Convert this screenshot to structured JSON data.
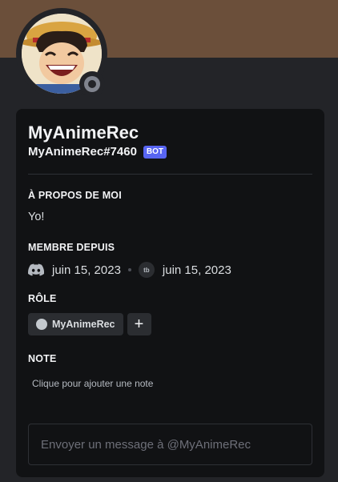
{
  "colors": {
    "banner": "#6b4f3a",
    "background": "#232428",
    "card": "#111214",
    "bot_badge": "#5865f2",
    "status_offline": "#80848e"
  },
  "profile": {
    "avatar_icon": "anime-avatar-icon",
    "status": "offline",
    "display_name": "MyAnimeRec",
    "username": "MyAnimeRec#7460",
    "bot_badge": "BOT"
  },
  "about": {
    "title": "À PROPOS DE MOI",
    "text": "Yo!"
  },
  "member_since": {
    "title": "MEMBRE DEPUIS",
    "discord_icon": "discord-icon",
    "discord_date": "juin 15, 2023",
    "server_icon_label": "tb",
    "server_date": "juin 15, 2023"
  },
  "role": {
    "title": "RÔLE",
    "roles": [
      {
        "name": "MyAnimeRec",
        "color": "#c4c9ce"
      }
    ],
    "add_label": "+"
  },
  "note": {
    "title": "NOTE",
    "placeholder": "Clique pour ajouter une note"
  },
  "message": {
    "placeholder": "Envoyer un message à @MyAnimeRec"
  }
}
